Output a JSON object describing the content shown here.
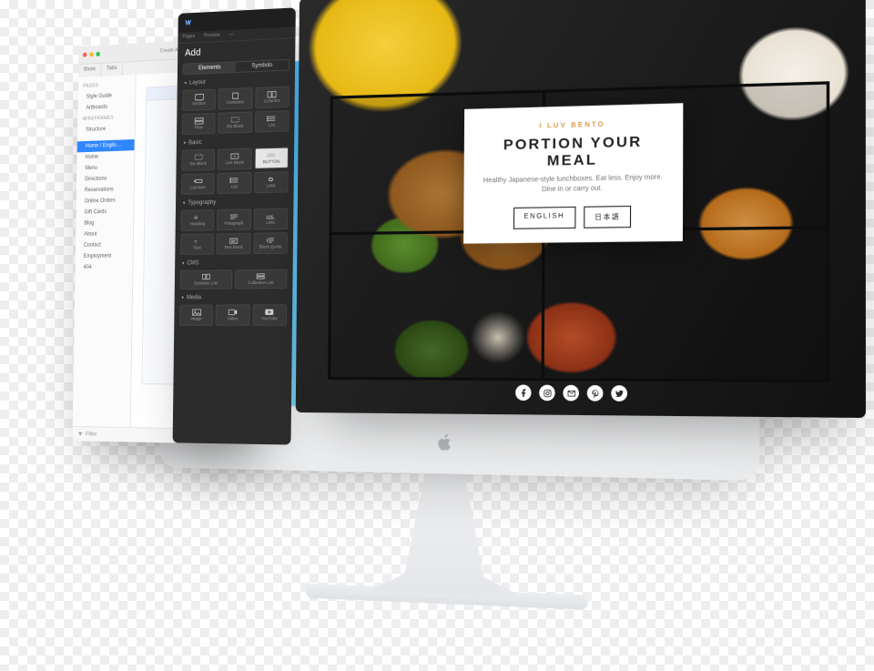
{
  "structure_app": {
    "window_tabs": [
      "Show",
      "Tabs"
    ],
    "toolbar_center": "Create Artboard",
    "nav": {
      "groups": [
        {
          "heading": "PAGES",
          "items": [
            "Style Guide",
            "Artboards"
          ]
        },
        {
          "heading": "WIREFRAMES",
          "items": [
            "Structure"
          ]
        }
      ],
      "tree_heading": "Home / Englis…",
      "tree": [
        "Home",
        "Menu",
        "Directions",
        "Reservations",
        "Online Orders",
        "Gift Cards",
        "Blog",
        "About",
        "Contact",
        "Employment",
        "404"
      ]
    },
    "footer_label": "Filter"
  },
  "add_panel": {
    "top_tabs": [
      "Pages",
      "Preview",
      "—"
    ],
    "title": "Add",
    "sub_tabs": {
      "left": "Elements",
      "right": "Symbols"
    },
    "sections": [
      {
        "name": "Layout",
        "cells": [
          {
            "icon": "section-icon",
            "label": "Section"
          },
          {
            "icon": "container-icon",
            "label": "Container"
          },
          {
            "icon": "columns-icon",
            "label": "Columns"
          },
          {
            "icon": "row-icon",
            "label": "Row"
          },
          {
            "icon": "divblock-icon",
            "label": "Div Block"
          },
          {
            "icon": "list-icon",
            "label": "List"
          }
        ]
      },
      {
        "name": "Basic",
        "cells": [
          {
            "icon": "divblock-icon",
            "label": "Div Block"
          },
          {
            "icon": "linkblock-icon",
            "label": "Link Block"
          },
          {
            "icon": "button-icon",
            "label": "BUTTON",
            "special": "btn"
          },
          {
            "icon": "listitem-icon",
            "label": "List Item"
          },
          {
            "icon": "list-icon",
            "label": "List"
          },
          {
            "icon": "link-icon",
            "label": "LINK"
          }
        ]
      },
      {
        "name": "Typography",
        "cells": [
          {
            "icon": "heading-icon",
            "label": "Heading"
          },
          {
            "icon": "paragraph-icon",
            "label": "Paragraph"
          },
          {
            "icon": "textlink-icon",
            "label": "LINK"
          },
          {
            "icon": "text-icon",
            "label": "Text"
          },
          {
            "icon": "textblock-icon",
            "label": "Text Block"
          },
          {
            "icon": "blockquote-icon",
            "label": "Block Quote"
          }
        ]
      },
      {
        "name": "CMS",
        "two": true,
        "cells": [
          {
            "icon": "dynlist-icon",
            "label": "Dynamic List"
          },
          {
            "icon": "collection-icon",
            "label": "Collection List"
          }
        ]
      },
      {
        "name": "Media",
        "cells": [
          {
            "icon": "image-icon",
            "label": "Image"
          },
          {
            "icon": "video-icon",
            "label": "Video"
          },
          {
            "icon": "youtube-icon",
            "label": "YouTube"
          }
        ]
      }
    ]
  },
  "hero": {
    "eyebrow": "I LUV BENTO",
    "title": "PORTION YOUR MEAL",
    "subtitle_1": "Healthy Japanese-style lunchboxes. Eat less. Enjoy more.",
    "subtitle_2": "Dine in or carry out.",
    "button_en": "ENGLISH",
    "button_jp": "日本語",
    "social": [
      "facebook-icon",
      "instagram-icon",
      "envelope-icon",
      "pinterest-icon",
      "twitter-icon"
    ]
  }
}
